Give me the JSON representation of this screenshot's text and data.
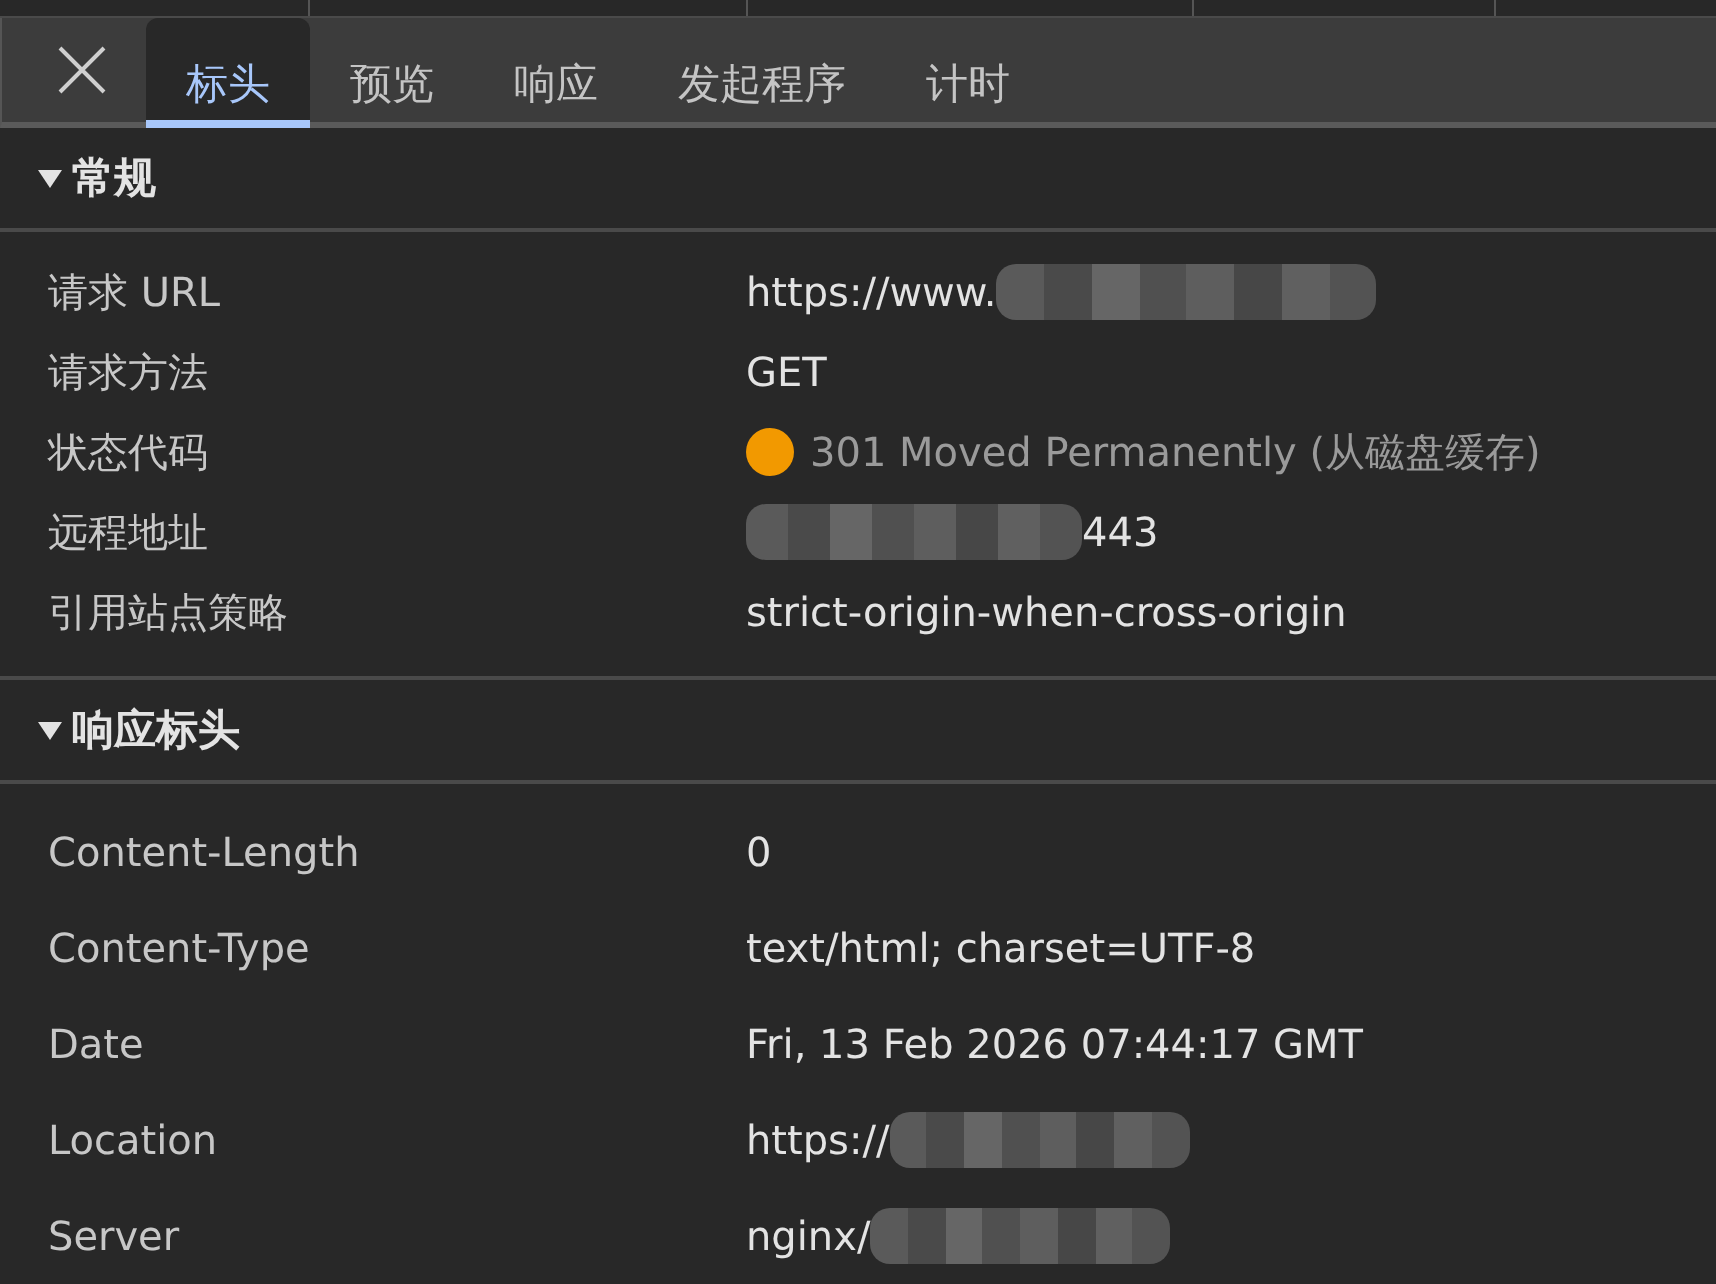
{
  "tabs": [
    {
      "label": "标头",
      "selected": true
    },
    {
      "label": "预览",
      "selected": false
    },
    {
      "label": "响应",
      "selected": false
    },
    {
      "label": "发起程序",
      "selected": false
    },
    {
      "label": "计时",
      "selected": false
    }
  ],
  "sections": [
    {
      "title": "常规",
      "expanded": true,
      "kind": "general",
      "rows": [
        {
          "name": "请求 URL",
          "value": "https://www.",
          "redacted_after": true
        },
        {
          "name": "请求方法",
          "value": "GET"
        },
        {
          "name": "状态代码",
          "value": "301 Moved Permanently (从磁盘缓存)",
          "kind": "status",
          "color": "#f29900"
        },
        {
          "name": "远程地址",
          "value": "443",
          "redacted_before": true
        },
        {
          "name": "引用站点策略",
          "value": "strict-origin-when-cross-origin"
        }
      ]
    },
    {
      "title": "响应标头",
      "expanded": true,
      "kind": "headers",
      "rows": [
        {
          "name": "Content-Length",
          "value": "0"
        },
        {
          "name": "Content-Type",
          "value": "text/html; charset=UTF-8"
        },
        {
          "name": "Date",
          "value": "Fri, 13 Feb 2026 07:44:17 GMT"
        },
        {
          "name": "Location",
          "value": "https://",
          "redacted_after": true
        },
        {
          "name": "Server",
          "value": "nginx/",
          "redacted_after": true
        }
      ]
    }
  ]
}
